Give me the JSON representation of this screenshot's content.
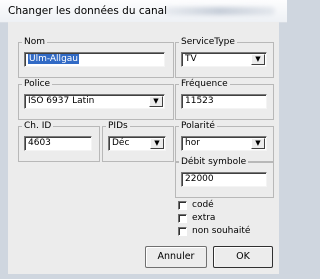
{
  "window": {
    "title": "Changer les données du canal"
  },
  "fields": {
    "nom": {
      "label": "Nom",
      "value": "Ulm-Allgau"
    },
    "service_type": {
      "label": "ServiceType",
      "value": "TV"
    },
    "police": {
      "label": "Police",
      "value": "ISO 6937 Latin"
    },
    "frequence": {
      "label": "Fréquence",
      "value": "11523"
    },
    "ch_id": {
      "label": "Ch. ID",
      "value": "4603"
    },
    "pids": {
      "label": "PIDs",
      "value": "Déc"
    },
    "polarite": {
      "label": "Polarité",
      "value": "hor"
    },
    "debit_symbole": {
      "label": "Débit symbole",
      "value": "22000"
    }
  },
  "checkboxes": [
    {
      "label": "codé",
      "checked": false
    },
    {
      "label": "extra",
      "checked": false
    },
    {
      "label": "non souhaité",
      "checked": false
    }
  ],
  "buttons": {
    "cancel": "Annuler",
    "ok": "OK"
  },
  "icons": {
    "dropdown": "chevron-down-icon"
  }
}
